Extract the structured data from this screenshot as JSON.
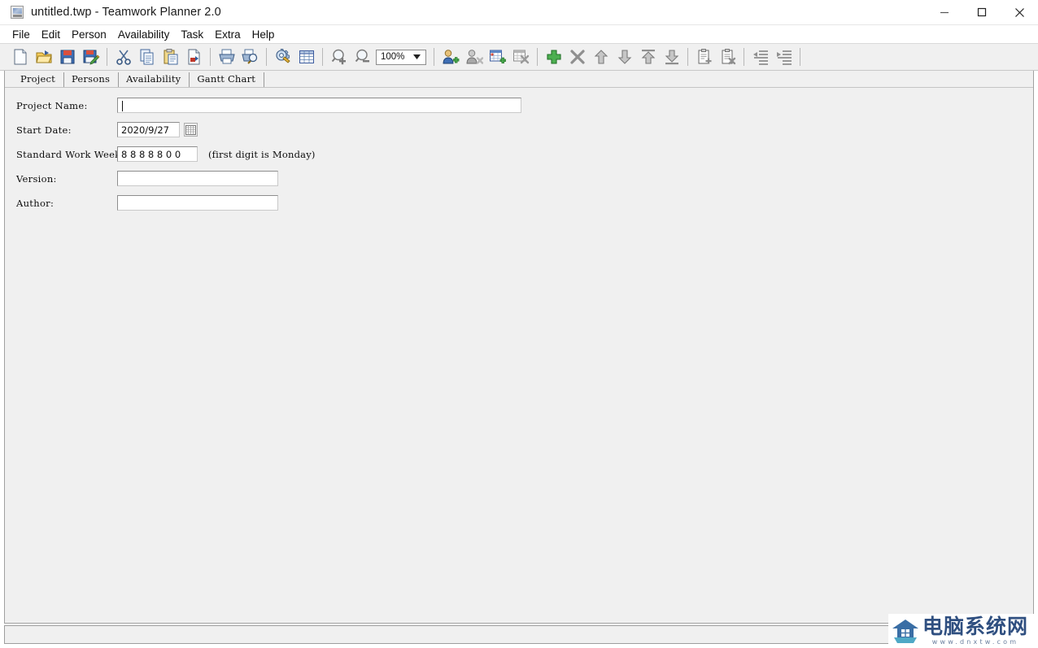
{
  "window": {
    "title": "untitled.twp - Teamwork Planner 2.0",
    "icon": "app-icon",
    "controls": [
      {
        "name": "minimize-button",
        "glyph": "minimize"
      },
      {
        "name": "maximize-button",
        "glyph": "maximize"
      },
      {
        "name": "close-button",
        "glyph": "close"
      }
    ]
  },
  "menubar": {
    "items": [
      {
        "label": "File"
      },
      {
        "label": "Edit"
      },
      {
        "label": "Person"
      },
      {
        "label": "Availability"
      },
      {
        "label": "Task"
      },
      {
        "label": "Extra"
      },
      {
        "label": "Help"
      }
    ]
  },
  "toolbar": {
    "zoom_value": "100%",
    "groups": [
      {
        "buttons": [
          {
            "name": "new-document-icon",
            "title": "New"
          },
          {
            "name": "open-folder-icon",
            "title": "Open"
          },
          {
            "name": "save-icon",
            "title": "Save"
          },
          {
            "name": "save-as-icon",
            "title": "Save As"
          }
        ]
      },
      {
        "buttons": [
          {
            "name": "cut-scissors-icon",
            "title": "Cut"
          },
          {
            "name": "copy-icon",
            "title": "Copy"
          },
          {
            "name": "paste-clipboard-icon",
            "title": "Paste"
          },
          {
            "name": "delete-document-icon",
            "title": "Delete"
          }
        ]
      },
      {
        "buttons": [
          {
            "name": "print-icon",
            "title": "Print"
          },
          {
            "name": "print-preview-icon",
            "title": "Print Preview"
          }
        ]
      },
      {
        "buttons": [
          {
            "name": "settings-gear-icon",
            "title": "Settings"
          },
          {
            "name": "table-grid-icon",
            "title": "Table"
          }
        ]
      },
      {
        "buttons": [
          {
            "name": "zoom-in-icon",
            "title": "Zoom In"
          },
          {
            "name": "zoom-out-icon",
            "title": "Zoom Out"
          }
        ]
      },
      {
        "buttons": [
          {
            "name": "add-person-icon",
            "title": "Add Person"
          },
          {
            "name": "remove-person-icon",
            "title": "Remove Person"
          },
          {
            "name": "add-availability-icon",
            "title": "Add Availability"
          },
          {
            "name": "remove-availability-icon",
            "title": "Remove Availability"
          }
        ]
      },
      {
        "buttons": [
          {
            "name": "add-task-plus-icon",
            "title": "Add Task"
          },
          {
            "name": "delete-task-cross-icon",
            "title": "Delete Task"
          },
          {
            "name": "move-up-icon",
            "title": "Move Up"
          },
          {
            "name": "move-down-icon",
            "title": "Move Down"
          },
          {
            "name": "move-to-top-icon",
            "title": "Move To Top"
          },
          {
            "name": "move-to-bottom-icon",
            "title": "Move To Bottom"
          }
        ]
      },
      {
        "buttons": [
          {
            "name": "new-subtask-icon",
            "title": "New Subtask"
          },
          {
            "name": "remove-subtask-icon",
            "title": "Remove Subtask"
          }
        ]
      },
      {
        "buttons": [
          {
            "name": "outdent-icon",
            "title": "Outdent"
          },
          {
            "name": "indent-icon",
            "title": "Indent"
          }
        ]
      }
    ]
  },
  "tabs": [
    {
      "label": "Project",
      "active": true
    },
    {
      "label": "Persons",
      "active": false
    },
    {
      "label": "Availability",
      "active": false
    },
    {
      "label": "Gantt Chart",
      "active": false
    }
  ],
  "project_form": {
    "project_name": {
      "label": "Project Name:",
      "value": "",
      "placeholder": ""
    },
    "start_date": {
      "label": "Start Date:",
      "value": "2020/9/27",
      "picker_icon": "calendar-icon"
    },
    "work_week": {
      "label": "Standard Work Week:",
      "value": "8 8 8 8 8 0 0",
      "hint": "(first digit is Monday)"
    },
    "version": {
      "label": "Version:",
      "value": "",
      "placeholder": ""
    },
    "author": {
      "label": "Author:",
      "value": "",
      "placeholder": ""
    }
  },
  "statusbar": {
    "text": ""
  },
  "watermark": {
    "name_cn": "电脑系统网",
    "url": "www.dnxtw.com"
  }
}
